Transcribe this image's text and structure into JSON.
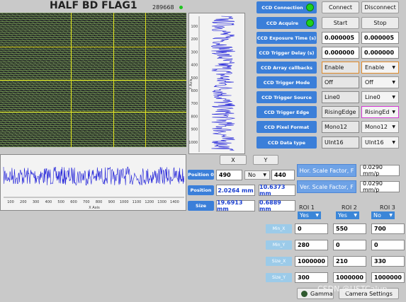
{
  "header": {
    "title": "HALF BD FLAG1",
    "counter": "289668"
  },
  "controls": [
    {
      "label": "CCD Connection",
      "led": true,
      "left": "Connect",
      "right": "Disconnect",
      "left_kind": "button",
      "right_kind": "button"
    },
    {
      "label": "CCD Acquire",
      "led": true,
      "left": "Start",
      "right": "Stop",
      "left_kind": "button",
      "right_kind": "button"
    },
    {
      "label": "CCD Exposure Time (s)",
      "left": "0.000005",
      "right": "0.000005",
      "left_kind": "num",
      "right_kind": "num"
    },
    {
      "label": "CCD Trigger Delay (s)",
      "left": "0.000000",
      "right": "0.000000",
      "left_kind": "num",
      "right_kind": "num"
    },
    {
      "label": "CCD Array callbacks",
      "left": "Enable",
      "right": "Enable",
      "left_kind": "ro",
      "right_kind": "sel"
    },
    {
      "label": "CCD Trigger Mode",
      "left": "Off",
      "right": "Off",
      "left_kind": "ro",
      "right_kind": "sel"
    },
    {
      "label": "CCD Trigger Source",
      "left": "Line0",
      "right": "Line0",
      "left_kind": "ro",
      "right_kind": "sel"
    },
    {
      "label": "CCD Trigger Edge",
      "left": "RisingEdge",
      "right": "RisingEd",
      "left_kind": "ro",
      "right_kind": "sel"
    },
    {
      "label": "CCD Pixel Format",
      "left": "Mono12",
      "right": "Mono12",
      "left_kind": "ro",
      "right_kind": "sel"
    },
    {
      "label": "CCD Data type",
      "left": "UInt16",
      "right": "UInt16",
      "left_kind": "ro",
      "right_kind": "sel"
    }
  ],
  "profile_x": {
    "ticks": [
      "100",
      "200",
      "300",
      "400",
      "500",
      "600",
      "700",
      "800",
      "900",
      "1000",
      "1100",
      "1200",
      "1300",
      "1400"
    ],
    "axis_label": "X Axis"
  },
  "profile_y": {
    "ticks": [
      "100",
      "200",
      "300",
      "400",
      "500",
      "600",
      "700",
      "800",
      "900",
      "1000"
    ],
    "axis_label": "Y Axis"
  },
  "position_panel": {
    "x_header": "X",
    "y_header": "Y",
    "position0_label": "Position 0",
    "position0_x": "490",
    "position0_select": "No",
    "position0_y": "440",
    "position_label": "Position",
    "position_x": "2.0264 mm",
    "position_y": "10.6373 mm",
    "size_label": "Size",
    "size_x": "19.6913 mm",
    "size_y": "0.6889 mm"
  },
  "scale": {
    "hor_label": "Hor. Scale Factor, F",
    "hor_value": "0.0290 mm/p",
    "ver_label": "Ver. Scale Factor, F",
    "ver_value": "0.0290 mm/p"
  },
  "roi": {
    "headers": [
      "ROI 1",
      "ROI 2",
      "ROI 3"
    ],
    "enable": [
      "Yes",
      "Yes",
      "No"
    ],
    "rows": [
      {
        "label": "Min_X",
        "values": [
          "0",
          "550",
          "700"
        ]
      },
      {
        "label": "Min_Y",
        "values": [
          "280",
          "0",
          "0"
        ]
      },
      {
        "label": "Size_X",
        "values": [
          "1000000",
          "210",
          "330"
        ]
      },
      {
        "label": "Size_Y",
        "values": [
          "300",
          "1000000",
          "1000000"
        ]
      }
    ]
  },
  "bottom": {
    "gamma": "Gamma",
    "camera_settings": "Camera Settings"
  },
  "watermark": "CSDN @USTCalup",
  "colors": {
    "accent": "#3b7fd9",
    "led_green": "#1fd11f",
    "plot_line": "#1e1ed8",
    "roi_box": "#e3e21a"
  }
}
